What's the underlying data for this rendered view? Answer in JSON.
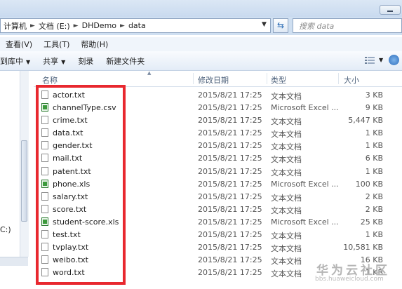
{
  "address": {
    "crumbs": [
      "计算机",
      "文档 (E:)",
      "DHDemo",
      "data"
    ]
  },
  "search": {
    "placeholder": "搜索 data"
  },
  "menu": {
    "items": [
      "查看(V)",
      "工具(T)",
      "帮助(H)"
    ]
  },
  "commands": {
    "library": "到库中",
    "share": "共享",
    "burn": "刻录",
    "new_folder": "新建文件夹"
  },
  "columns": {
    "name": "名称",
    "date": "修改日期",
    "type": "类型",
    "size": "大小"
  },
  "nav": {
    "partial_label": "C:)"
  },
  "files": [
    {
      "name": "actor.txt",
      "date": "2015/8/21 17:25",
      "type": "文本文档",
      "size": "3 KB",
      "icon": "text-file-icon"
    },
    {
      "name": "channelType.csv",
      "date": "2015/8/21 17:25",
      "type": "Microsoft Excel ...",
      "size": "9 KB",
      "icon": "excel-file-icon"
    },
    {
      "name": "crime.txt",
      "date": "2015/8/21 17:25",
      "type": "文本文档",
      "size": "5,447 KB",
      "icon": "text-file-icon"
    },
    {
      "name": "data.txt",
      "date": "2015/8/21 17:25",
      "type": "文本文档",
      "size": "1 KB",
      "icon": "text-file-icon"
    },
    {
      "name": "gender.txt",
      "date": "2015/8/21 17:25",
      "type": "文本文档",
      "size": "1 KB",
      "icon": "text-file-icon"
    },
    {
      "name": "mail.txt",
      "date": "2015/8/21 17:25",
      "type": "文本文档",
      "size": "6 KB",
      "icon": "text-file-icon"
    },
    {
      "name": "patent.txt",
      "date": "2015/8/21 17:25",
      "type": "文本文档",
      "size": "1 KB",
      "icon": "text-file-icon"
    },
    {
      "name": "phone.xls",
      "date": "2015/8/21 17:25",
      "type": "Microsoft Excel ...",
      "size": "100 KB",
      "icon": "excel-file-icon"
    },
    {
      "name": "salary.txt",
      "date": "2015/8/21 17:25",
      "type": "文本文档",
      "size": "2 KB",
      "icon": "text-file-icon"
    },
    {
      "name": "score.txt",
      "date": "2015/8/21 17:25",
      "type": "文本文档",
      "size": "2 KB",
      "icon": "text-file-icon"
    },
    {
      "name": "student-score.xls",
      "date": "2015/8/21 17:25",
      "type": "Microsoft Excel ...",
      "size": "25 KB",
      "icon": "excel-file-icon"
    },
    {
      "name": "test.txt",
      "date": "2015/8/21 17:25",
      "type": "文本文档",
      "size": "1 KB",
      "icon": "text-file-icon"
    },
    {
      "name": "tvplay.txt",
      "date": "2015/8/21 17:25",
      "type": "文本文档",
      "size": "10,581 KB",
      "icon": "text-file-icon"
    },
    {
      "name": "weibo.txt",
      "date": "2015/8/21 17:25",
      "type": "文本文档",
      "size": "16 KB",
      "icon": "text-file-icon"
    },
    {
      "name": "word.txt",
      "date": "2015/8/21 17:25",
      "type": "文本文档",
      "size": "1 KB",
      "icon": "text-file-icon"
    }
  ],
  "highlight_color": "#e8282f",
  "watermark": {
    "logo": "华为云社区",
    "url": "bbs.huaweicloud.com"
  }
}
